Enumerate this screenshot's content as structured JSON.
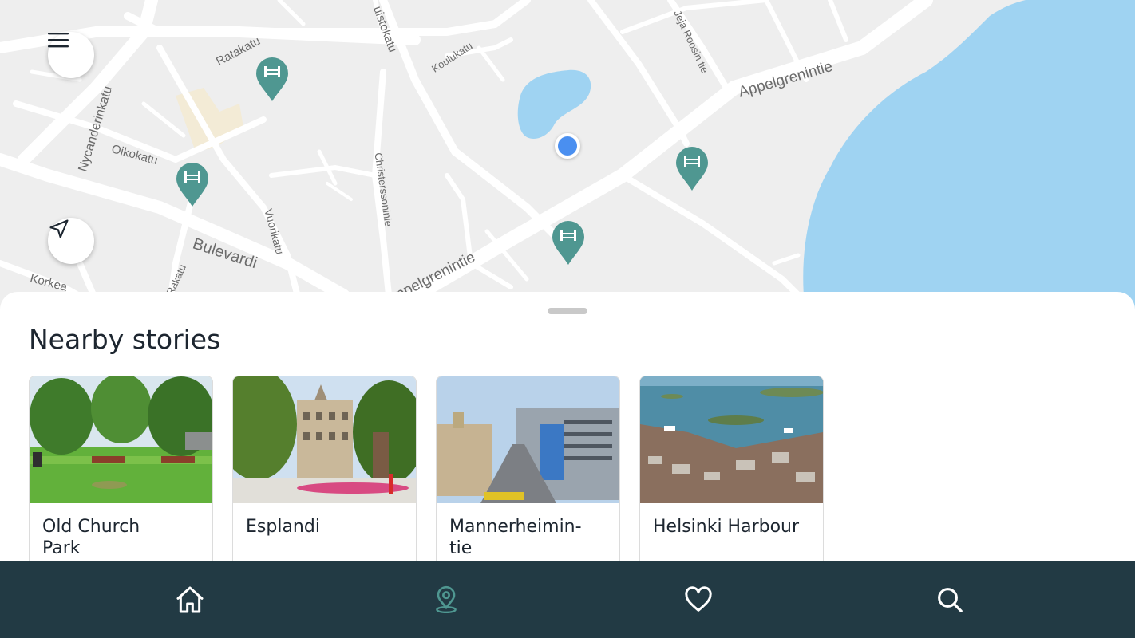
{
  "map": {
    "streets": [
      "Ratakatu",
      "Nycanderinkatu",
      "Oikokatu",
      "Bulevardi",
      "Vuorikatu",
      "Christerssoninie",
      "Koulukatu",
      "uistokatu",
      "Jeja Roosin tie",
      "Appelgrenintie",
      "Appelgrenintie",
      "Korkea",
      "Rakatu"
    ],
    "menu_icon": "hamburger-icon",
    "locate_icon": "navigation-arrow-icon",
    "pin_icon": "bridge-pin-icon",
    "water_color": "#9fd3f2",
    "pin_color": "#4f9791",
    "user_location_color": "#4a8ff0"
  },
  "sheet": {
    "title": "Nearby stories",
    "cards": [
      {
        "title": "Old Church\nPark",
        "image": "park-photo"
      },
      {
        "title": "Esplandi",
        "image": "esplanade-photo"
      },
      {
        "title": "Mannerheimin-\ntie",
        "image": "avenue-photo"
      },
      {
        "title": "Helsinki Harbour",
        "image": "harbour-photo"
      }
    ]
  },
  "nav": {
    "items": [
      {
        "name": "home",
        "icon": "home-icon",
        "active": false
      },
      {
        "name": "map",
        "icon": "map-pin-icon",
        "active": true
      },
      {
        "name": "favorites",
        "icon": "heart-icon",
        "active": false
      },
      {
        "name": "search",
        "icon": "search-icon",
        "active": false
      }
    ],
    "background": "#223a44",
    "active_color": "#4f9791",
    "inactive_color": "#ffffff"
  }
}
